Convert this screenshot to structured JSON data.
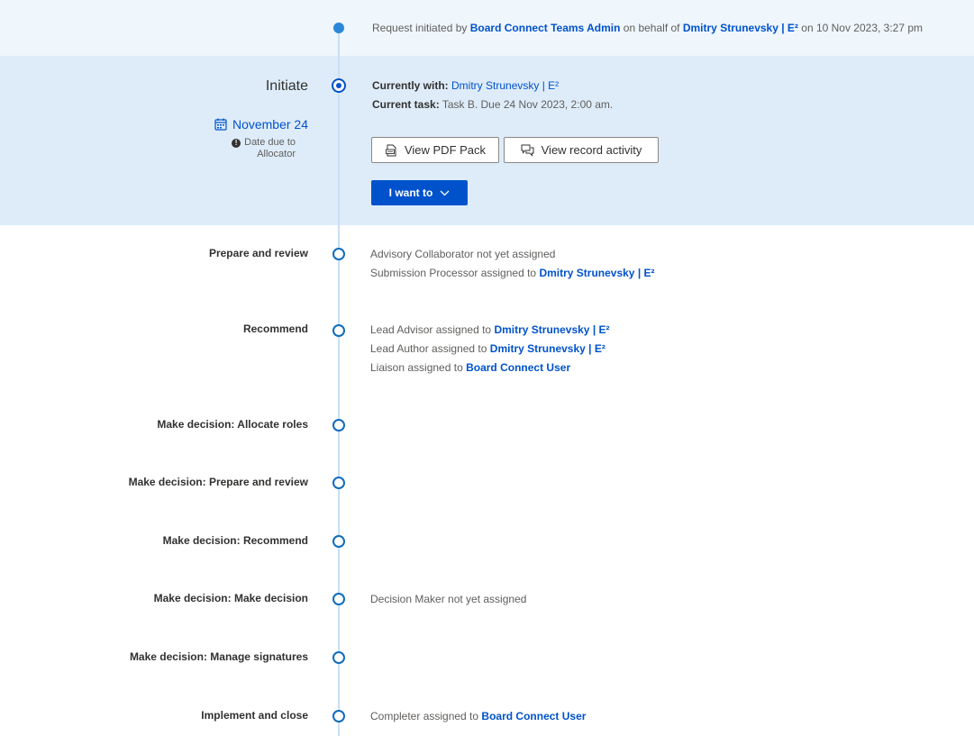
{
  "history": {
    "prefix": "Request initiated by",
    "initiator": "Board Connect Teams Admin",
    "middle": "on behalf of",
    "behalf_of": "Dmitry Strunevsky | E²",
    "suffix": "on 10 Nov 2023, 3:27 pm"
  },
  "current_stage": {
    "title": "Initiate",
    "due_date": "November 24",
    "due_note_line1": "Date due to",
    "due_note_line2": "Allocator",
    "currently_with_label": "Currently with:",
    "currently_with": "Dmitry Strunevsky | E²",
    "current_task_label": "Current task:",
    "current_task": "Task B. Due 24 Nov 2023, 2:00 am.",
    "buttons": {
      "pdf": "View PDF Pack",
      "activity": "View record activity",
      "i_want_to": "I want to"
    }
  },
  "stages": [
    {
      "title": "Prepare and review",
      "lines": [
        {
          "text": "Advisory Collaborator not yet assigned",
          "link": ""
        },
        {
          "text": "Submission Processor assigned to",
          "link": "Dmitry Strunevsky | E²"
        }
      ]
    },
    {
      "title": "Recommend",
      "lines": [
        {
          "text": "Lead Advisor assigned to",
          "link": "Dmitry Strunevsky | E²"
        },
        {
          "text": "Lead Author assigned to",
          "link": "Dmitry Strunevsky | E²"
        },
        {
          "text": "Liaison assigned to",
          "link": "Board Connect User"
        }
      ]
    },
    {
      "title": "Make decision: Allocate roles",
      "lines": []
    },
    {
      "title": "Make decision: Prepare and review",
      "lines": []
    },
    {
      "title": "Make decision: Recommend",
      "lines": []
    },
    {
      "title": "Make decision: Make decision",
      "lines": [
        {
          "text": "Decision Maker not yet assigned",
          "link": ""
        }
      ]
    },
    {
      "title": "Make decision: Manage signatures",
      "lines": []
    },
    {
      "title": "Implement and close",
      "lines": [
        {
          "text": "Completer assigned to",
          "link": "Board Connect User"
        }
      ]
    }
  ],
  "colors": {
    "accent": "#0052cc",
    "band_top": "#eff6fc",
    "band_current": "#deecf9",
    "timeline": "#c7e0f4"
  },
  "icons": {
    "due_date": "calendar-icon",
    "due_note": "exclamation-circle-icon",
    "pdf": "pdf-file-icon",
    "activity": "chat-bubbles-icon",
    "menu": "chevron-down-icon"
  }
}
